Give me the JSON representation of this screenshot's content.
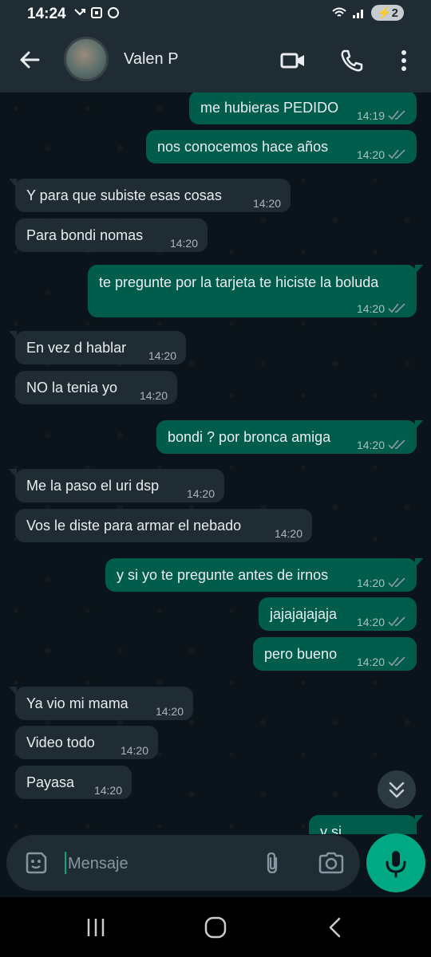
{
  "status": {
    "time": "14:24",
    "battery": "2"
  },
  "header": {
    "contact_name": "Valen P",
    "icons": [
      "back-arrow-icon",
      "video-call-icon",
      "phone-icon",
      "more-vert-icon"
    ]
  },
  "messages": [
    {
      "text": "me hubieras PEDIDO",
      "time": "14:19",
      "dir": "out"
    },
    {
      "text": "nos conocemos hace años",
      "time": "14:20",
      "dir": "out"
    },
    {
      "text": "Y para que subiste esas cosas",
      "time": "14:20",
      "dir": "in"
    },
    {
      "text": "Para bondi nomas",
      "time": "14:20",
      "dir": "in"
    },
    {
      "text": "te pregunte por la tarjeta te hiciste la boluda",
      "time": "14:20",
      "dir": "out"
    },
    {
      "text": "En vez d hablar",
      "time": "14:20",
      "dir": "in"
    },
    {
      "text": "NO la tenia yo",
      "time": "14:20",
      "dir": "in"
    },
    {
      "text": "bondi ? por bronca amiga",
      "time": "14:20",
      "dir": "out"
    },
    {
      "text": "Me la paso el uri dsp",
      "time": "14:20",
      "dir": "in"
    },
    {
      "text": "Vos le diste para armar el nebado",
      "time": "14:20",
      "dir": "in"
    },
    {
      "text": "y si yo te pregunte antes de irnos",
      "time": "14:20",
      "dir": "out"
    },
    {
      "text": "jajajajajaja",
      "time": "14:20",
      "dir": "out"
    },
    {
      "text": "pero bueno",
      "time": "14:20",
      "dir": "out"
    },
    {
      "text": "Ya vio mi mama",
      "time": "14:20",
      "dir": "in"
    },
    {
      "text": "Video todo",
      "time": "14:20",
      "dir": "in"
    },
    {
      "text": "Payasa",
      "time": "14:20",
      "dir": "in"
    },
    {
      "text": "y si",
      "time": "",
      "dir": "out"
    }
  ],
  "composer": {
    "placeholder": "Mensaje"
  },
  "colors": {
    "background": "#0b141a",
    "incoming_bubble": "#202c33",
    "outgoing_bubble": "#005c4b",
    "accent": "#00a884",
    "bar": "#1f2c34"
  }
}
